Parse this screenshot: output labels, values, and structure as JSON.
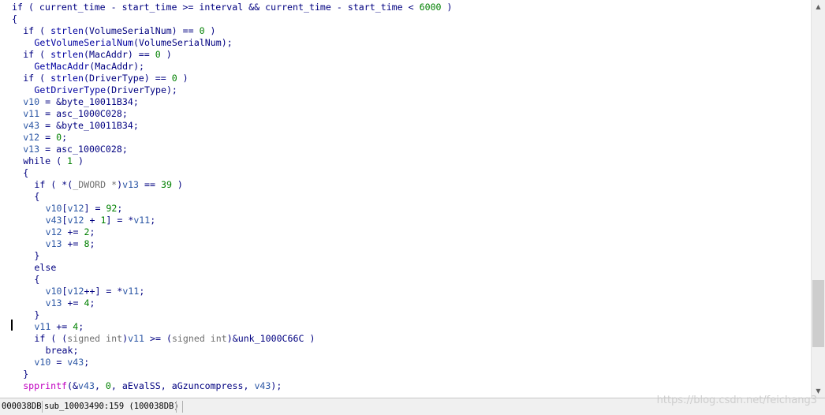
{
  "code": {
    "lines": [
      [
        [
          "kw",
          "if ( "
        ],
        [
          "id",
          "current_time"
        ],
        [
          "punc",
          " - "
        ],
        [
          "id",
          "start_time"
        ],
        [
          "punc",
          " >= "
        ],
        [
          "id",
          "interval"
        ],
        [
          "punc",
          " && "
        ],
        [
          "id",
          "current_time"
        ],
        [
          "punc",
          " - "
        ],
        [
          "id",
          "start_time"
        ],
        [
          "punc",
          " < "
        ],
        [
          "num",
          "6000"
        ],
        [
          "punc",
          " )"
        ]
      ],
      [
        [
          "punc",
          "{"
        ]
      ],
      [
        [
          "kw",
          "if ( "
        ],
        [
          "func",
          "strlen"
        ],
        [
          "punc",
          "("
        ],
        [
          "id",
          "VolumeSerialNum"
        ],
        [
          "punc",
          ") == "
        ],
        [
          "num",
          "0"
        ],
        [
          "punc",
          " )"
        ]
      ],
      [
        [
          "func",
          "GetVolumeSerialNum"
        ],
        [
          "punc",
          "("
        ],
        [
          "id",
          "VolumeSerialNum"
        ],
        [
          "punc",
          ");"
        ]
      ],
      [
        [
          "kw",
          "if ( "
        ],
        [
          "func",
          "strlen"
        ],
        [
          "punc",
          "("
        ],
        [
          "id",
          "MacAddr"
        ],
        [
          "punc",
          ") == "
        ],
        [
          "num",
          "0"
        ],
        [
          "punc",
          " )"
        ]
      ],
      [
        [
          "func",
          "GetMacAddr"
        ],
        [
          "punc",
          "("
        ],
        [
          "id",
          "MacAddr"
        ],
        [
          "punc",
          ");"
        ]
      ],
      [
        [
          "kw",
          "if ( "
        ],
        [
          "func",
          "strlen"
        ],
        [
          "punc",
          "("
        ],
        [
          "id",
          "DriverType"
        ],
        [
          "punc",
          ") == "
        ],
        [
          "num",
          "0"
        ],
        [
          "punc",
          " )"
        ]
      ],
      [
        [
          "func",
          "GetDriverType"
        ],
        [
          "punc",
          "("
        ],
        [
          "id",
          "DriverType"
        ],
        [
          "punc",
          ");"
        ]
      ],
      [
        [
          "var",
          "v10"
        ],
        [
          "punc",
          " = &"
        ],
        [
          "id",
          "byte_10011B34"
        ],
        [
          "punc",
          ";"
        ]
      ],
      [
        [
          "var",
          "v11"
        ],
        [
          "punc",
          " = "
        ],
        [
          "id",
          "asc_1000C028"
        ],
        [
          "punc",
          ";"
        ]
      ],
      [
        [
          "var",
          "v43"
        ],
        [
          "punc",
          " = &"
        ],
        [
          "id",
          "byte_10011B34"
        ],
        [
          "punc",
          ";"
        ]
      ],
      [
        [
          "var",
          "v12"
        ],
        [
          "punc",
          " = "
        ],
        [
          "num",
          "0"
        ],
        [
          "punc",
          ";"
        ]
      ],
      [
        [
          "var",
          "v13"
        ],
        [
          "punc",
          " = "
        ],
        [
          "id",
          "asc_1000C028"
        ],
        [
          "punc",
          ";"
        ]
      ],
      [
        [
          "kw",
          "while ( "
        ],
        [
          "num",
          "1"
        ],
        [
          "punc",
          " )"
        ]
      ],
      [
        [
          "punc",
          "{"
        ]
      ],
      [
        [
          "kw",
          "if ( "
        ],
        [
          "punc",
          "*("
        ],
        [
          "type",
          "_DWORD *"
        ],
        [
          "punc",
          ")"
        ],
        [
          "var",
          "v13"
        ],
        [
          "punc",
          " == "
        ],
        [
          "num",
          "39"
        ],
        [
          "punc",
          " )"
        ]
      ],
      [
        [
          "punc",
          "{"
        ]
      ],
      [
        [
          "var",
          "v10"
        ],
        [
          "punc",
          "["
        ],
        [
          "var",
          "v12"
        ],
        [
          "punc",
          "] = "
        ],
        [
          "num",
          "92"
        ],
        [
          "punc",
          ";"
        ]
      ],
      [
        [
          "var",
          "v43"
        ],
        [
          "punc",
          "["
        ],
        [
          "var",
          "v12"
        ],
        [
          "punc",
          " + "
        ],
        [
          "num",
          "1"
        ],
        [
          "punc",
          "] = *"
        ],
        [
          "var",
          "v11"
        ],
        [
          "punc",
          ";"
        ]
      ],
      [
        [
          "var",
          "v12"
        ],
        [
          "punc",
          " += "
        ],
        [
          "num",
          "2"
        ],
        [
          "punc",
          ";"
        ]
      ],
      [
        [
          "var",
          "v13"
        ],
        [
          "punc",
          " += "
        ],
        [
          "num",
          "8"
        ],
        [
          "punc",
          ";"
        ]
      ],
      [
        [
          "punc",
          "}"
        ]
      ],
      [
        [
          "kw",
          "else"
        ]
      ],
      [
        [
          "punc",
          "{"
        ]
      ],
      [
        [
          "var",
          "v10"
        ],
        [
          "punc",
          "["
        ],
        [
          "var",
          "v12"
        ],
        [
          "punc",
          "++] = *"
        ],
        [
          "var",
          "v11"
        ],
        [
          "punc",
          ";"
        ]
      ],
      [
        [
          "var",
          "v13"
        ],
        [
          "punc",
          " += "
        ],
        [
          "num",
          "4"
        ],
        [
          "punc",
          ";"
        ]
      ],
      [
        [
          "punc",
          "}"
        ]
      ],
      [
        [
          "var",
          "v11"
        ],
        [
          "punc",
          " += "
        ],
        [
          "num",
          "4"
        ],
        [
          "punc",
          ";"
        ]
      ],
      [
        [
          "kw",
          "if ( ("
        ],
        [
          "type",
          "signed int"
        ],
        [
          "punc",
          ")"
        ],
        [
          "var",
          "v11"
        ],
        [
          "punc",
          " >= ("
        ],
        [
          "type",
          "signed int"
        ],
        [
          "punc",
          ")&"
        ],
        [
          "id",
          "unk_1000C66C"
        ],
        [
          "punc",
          " )"
        ]
      ],
      [
        [
          "kw",
          "break"
        ],
        [
          "punc",
          ";"
        ]
      ],
      [
        [
          "var",
          "v10"
        ],
        [
          "punc",
          " = "
        ],
        [
          "var",
          "v43"
        ],
        [
          "punc",
          ";"
        ]
      ],
      [
        [
          "punc",
          "}"
        ]
      ],
      [
        [
          "lib",
          "spprintf"
        ],
        [
          "punc",
          "(&"
        ],
        [
          "var",
          "v43"
        ],
        [
          "punc",
          ", "
        ],
        [
          "num",
          "0"
        ],
        [
          "punc",
          ", "
        ],
        [
          "id",
          "aEvalSS"
        ],
        [
          "punc",
          ", "
        ],
        [
          "id",
          "aGzuncompress"
        ],
        [
          "punc",
          ", "
        ],
        [
          "var",
          "v43"
        ],
        [
          "punc",
          ");"
        ]
      ]
    ],
    "indent_levels": [
      0,
      0,
      1,
      2,
      1,
      2,
      1,
      2,
      1,
      1,
      1,
      1,
      1,
      1,
      1,
      2,
      2,
      3,
      3,
      3,
      3,
      2,
      2,
      2,
      3,
      3,
      2,
      2,
      2,
      3,
      2,
      1,
      1
    ],
    "colors": {
      "keyword": "#000080",
      "variable": "#2c57a5",
      "number": "#008000",
      "library_function": "#c000c0",
      "type_cast": "#707070"
    }
  },
  "status_bar": {
    "address": "000038DB",
    "location": "sub_10003490:159 (100038DB)"
  },
  "watermark": "https://blog.csdn.net/feichang3"
}
